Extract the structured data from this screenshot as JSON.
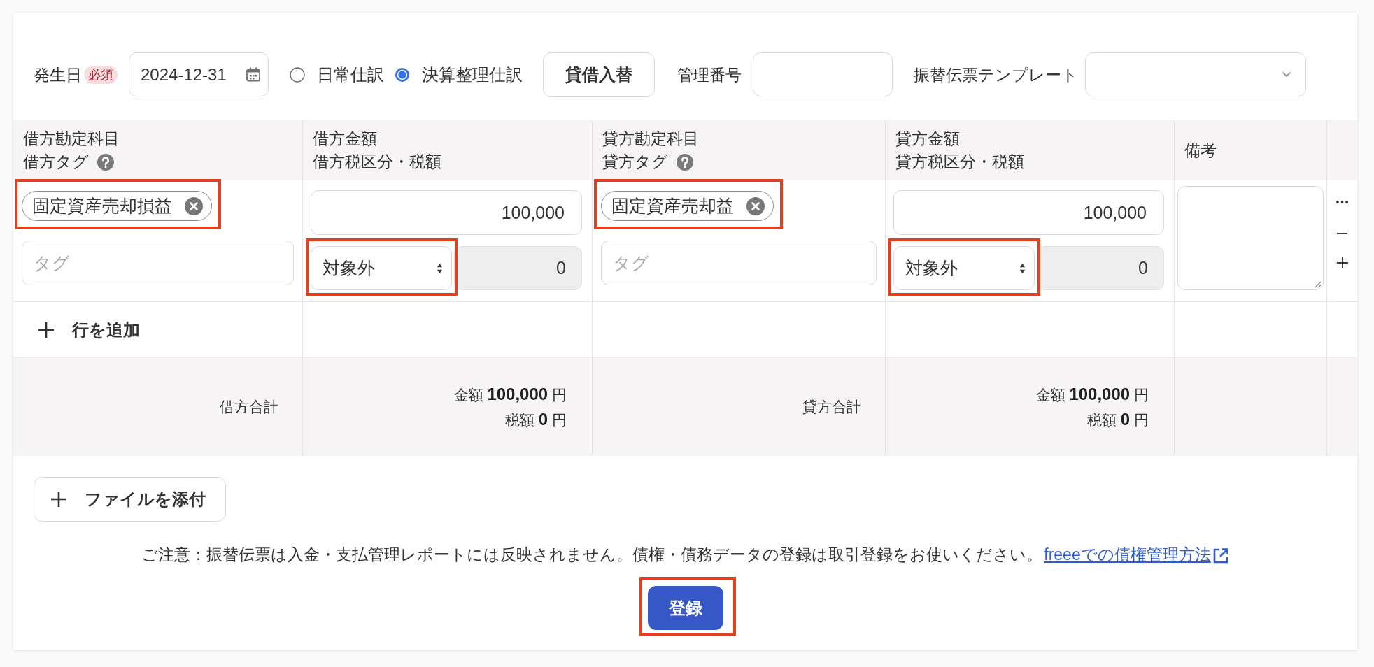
{
  "form_header": {
    "date": {
      "label": "発生日",
      "badge": "必須",
      "value": "2024-12-31"
    },
    "entry_types": [
      {
        "label": "日常仕訳",
        "selected": false
      },
      {
        "label": "決算整理仕訳",
        "selected": true
      }
    ],
    "swap_button": "貸借入替",
    "management_number": {
      "label": "管理番号"
    },
    "template": {
      "label": "振替伝票テンプレート"
    }
  },
  "table": {
    "columns": [
      {
        "lines": [
          "借方勘定科目",
          "借方タグ"
        ],
        "help": true
      },
      {
        "lines": [
          "借方金額",
          "借方税区分・税額"
        ],
        "help": false
      },
      {
        "lines": [
          "貸方勘定科目",
          "貸方タグ"
        ],
        "help": true
      },
      {
        "lines": [
          "貸方金額",
          "貸方税区分・税額"
        ],
        "help": false
      },
      {
        "lines": [
          "備考"
        ],
        "help": false
      }
    ],
    "rows": [
      {
        "sides": [
          {
            "account": {
              "label": "固定資産売却損益",
              "highlighted": true
            },
            "tag": {
              "placeholder": "タグ"
            },
            "amount": "100,000",
            "tax": {
              "category": "対象外",
              "highlighted": true
            },
            "tax_amount": "0"
          },
          {
            "account": {
              "label": "固定資産売却益",
              "highlighted": true
            },
            "tag": {
              "placeholder": "タグ"
            },
            "amount": "100,000",
            "tax": {
              "category": "対象外",
              "highlighted": true
            },
            "tax_amount": "0"
          }
        ]
      }
    ],
    "add_row_button": "行を追加",
    "totals": [
      {
        "label": "借方合計",
        "lines": [
          "金額 **100,000** 円",
          "税額 **0** 円"
        ]
      },
      {
        "label": "貸方合計",
        "lines": [
          "金額 **100,000** 円",
          "税額 **0** 円"
        ]
      }
    ]
  },
  "attach_button": "ファイルを添付",
  "notice": {
    "text": "ご注意：振替伝票は入金・支払管理レポートには反映されません。債権・債務データの登録は取引登録をお使いください。",
    "link": "freeeでの債権管理方法"
  },
  "submit_button": {
    "label": "登録",
    "highlighted": true
  }
}
